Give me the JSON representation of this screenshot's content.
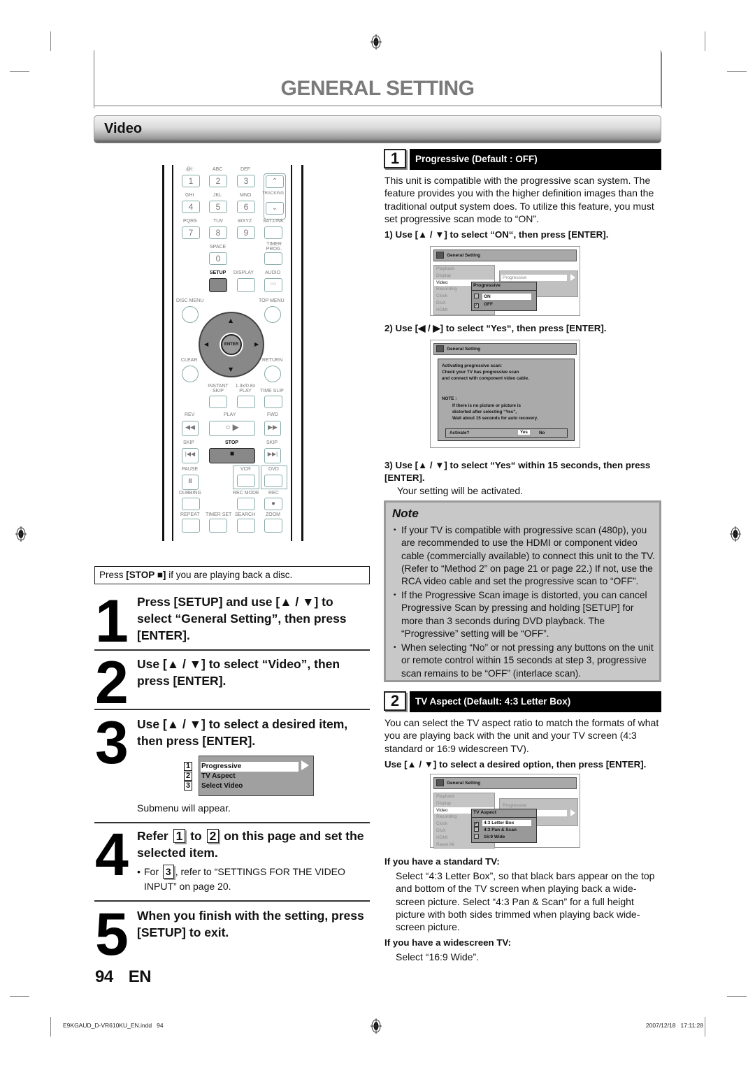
{
  "header": {
    "title": "GENERAL SETTING",
    "section": "Video"
  },
  "remote": {
    "labels_row1": [
      ".@/:",
      "ABC",
      "DEF"
    ],
    "keys_row1": [
      "1",
      "2",
      "3"
    ],
    "labels_row2": [
      "GHI",
      "JKL",
      "MNO"
    ],
    "keys_row2": [
      "4",
      "5",
      "6"
    ],
    "tracking": "TRACKING",
    "labels_row3": [
      "PQRS",
      "TUV",
      "WXYZ",
      "SAT.LINK"
    ],
    "keys_row3": [
      "7",
      "8",
      "9"
    ],
    "space": "SPACE",
    "timer_prog": "TIMER PROG.",
    "key_0": "0",
    "setup": "SETUP",
    "display": "DISPLAY",
    "audio": "AUDIO",
    "disc_menu": "DISC MENU",
    "top_menu": "TOP MENU",
    "enter": "ENTER",
    "clear": "CLEAR",
    "return": "RETURN",
    "instant_skip": "INSTANT SKIP",
    "play_speed": "1.3x/0.8x PLAY",
    "time_slip": "TIME SLIP",
    "rev": "REV",
    "play": "PLAY",
    "fwd": "FWD",
    "skip_back": "SKIP",
    "stop": "STOP",
    "skip_fwd": "SKIP",
    "pause": "PAUSE",
    "vcr": "VCR",
    "dvd": "DVD",
    "dubbing": "DUBBING",
    "rec_mode": "REC MODE",
    "rec": "REC",
    "repeat": "REPEAT",
    "timer_set": "TIMER SET",
    "search": "SEARCH",
    "zoom": "ZOOM"
  },
  "left": {
    "stop_note_pre": "Press ",
    "stop_note_bold": "[STOP ■]",
    "stop_note_post": " if you are playing back a disc.",
    "steps": [
      {
        "num": "1",
        "text": "Press [SETUP] and use [▲ / ▼] to select “General Setting”, then press [ENTER]."
      },
      {
        "num": "2",
        "text": "Use [▲ / ▼] to select “Video”, then press [ENTER]."
      },
      {
        "num": "3",
        "text": "Use [▲ / ▼] to select a desired item, then press [ENTER].",
        "sub": "Submenu will appear."
      },
      {
        "num": "4",
        "text_pre": "Refer ",
        "box1": "1",
        "text_mid": " to ",
        "box2": "2",
        "text_post": " on this page and set the selected item.",
        "sub_pre": "For ",
        "sub_box": "3",
        "sub_post": ", refer to “SETTINGS FOR THE VIDEO INPUT” on page 20."
      },
      {
        "num": "5",
        "text": "When you finish with the setting, press [SETUP] to exit."
      }
    ],
    "submenu": {
      "items": [
        {
          "num": "1",
          "label": "Progressive"
        },
        {
          "num": "2",
          "label": "TV Aspect"
        },
        {
          "num": "3",
          "label": "Select Video"
        }
      ]
    }
  },
  "right": {
    "section1": {
      "num": "1",
      "title": "Progressive (Default : OFF)",
      "body": "This unit is compatible with the progressive scan system. The feature provides you with the higher definition images than the traditional output system does. To utilize this feature, you must set progressive scan mode to “ON”.",
      "instr1": "1) Use [▲ / ▼] to select “ON“, then press [ENTER].",
      "instr2": "2) Use [◀ / ▶] to select “Yes“, then press [ENTER].",
      "instr3": "3) Use [▲ / ▼] to select “Yes“ within 15 seconds, then press [ENTER].",
      "instr3_sub": "Your setting will be activated."
    },
    "osd_common": {
      "header": "General Setting",
      "menu": [
        "Playback",
        "Display",
        "Video",
        "Recording",
        "Clock",
        "DivX",
        "HDMI",
        "Reset All"
      ],
      "right_item": "Progressive"
    },
    "osd1": {
      "popup_title": "Progressive",
      "options": [
        {
          "label": "ON",
          "checked": false
        },
        {
          "label": "OFF",
          "checked": true
        }
      ]
    },
    "osd2": {
      "lines": [
        "Activating progressive scan:",
        "Check your TV has progressive scan",
        "and connect with component video cable.",
        "NOTE :",
        "If there is no picture or picture is",
        "distorted after selecting “Yes”,",
        "Wait about 15 seconds for auto recovery."
      ],
      "activate": "Activate?",
      "yes": "Yes",
      "no": "No"
    },
    "note": {
      "title": "Note",
      "items": [
        "If your TV is compatible with progressive scan (480p), you are recommended to use the HDMI or component video cable (commercially available) to connect this unit to the TV. (Refer to “Method 2” on page 21 or page 22.) If not, use the RCA video cable and set the progressive scan to “OFF”.",
        "If the Progressive Scan image is distorted, you can cancel Progressive Scan by pressing and holding [SETUP] for more than 3 seconds during DVD playback. The “Progressive” setting will be “OFF”.",
        "When selecting “No” or not pressing any buttons on the unit or remote control within 15 seconds at step 3, progressive scan remains to be “OFF” (interlace scan)."
      ]
    },
    "section2": {
      "num": "2",
      "title": "TV Aspect (Default: 4:3 Letter Box)",
      "body": "You can select the TV aspect ratio to match the formats of what you are playing back with the unit and your TV screen (4:3 standard or 16:9 widescreen TV).",
      "instr": "Use [▲ / ▼] to select a desired option, then press [ENTER].",
      "standard_head": "If you have a standard TV:",
      "standard_body": "Select “4:3 Letter Box”, so that black bars appear on the top and bottom of the TV screen when playing back a wide-screen picture. Select “4:3 Pan & Scan” for a full height picture with both sides trimmed when playing back wide-screen picture.",
      "wide_head": "If you have a widescreen TV:",
      "wide_body": "Select “16:9 Wide”."
    },
    "osd3": {
      "popup_title": "TV Aspect",
      "options": [
        {
          "label": "4:3 Letter Box",
          "checked": true
        },
        {
          "label": "4:3 Pan & Scan",
          "checked": false
        },
        {
          "label": "16:9 Wide",
          "checked": false
        }
      ]
    }
  },
  "footer": {
    "page": "94",
    "lang": "EN",
    "file": "E9KGAUD_D-VR610KU_EN.indd   94",
    "date": "2007/12/18   17:11:28"
  }
}
